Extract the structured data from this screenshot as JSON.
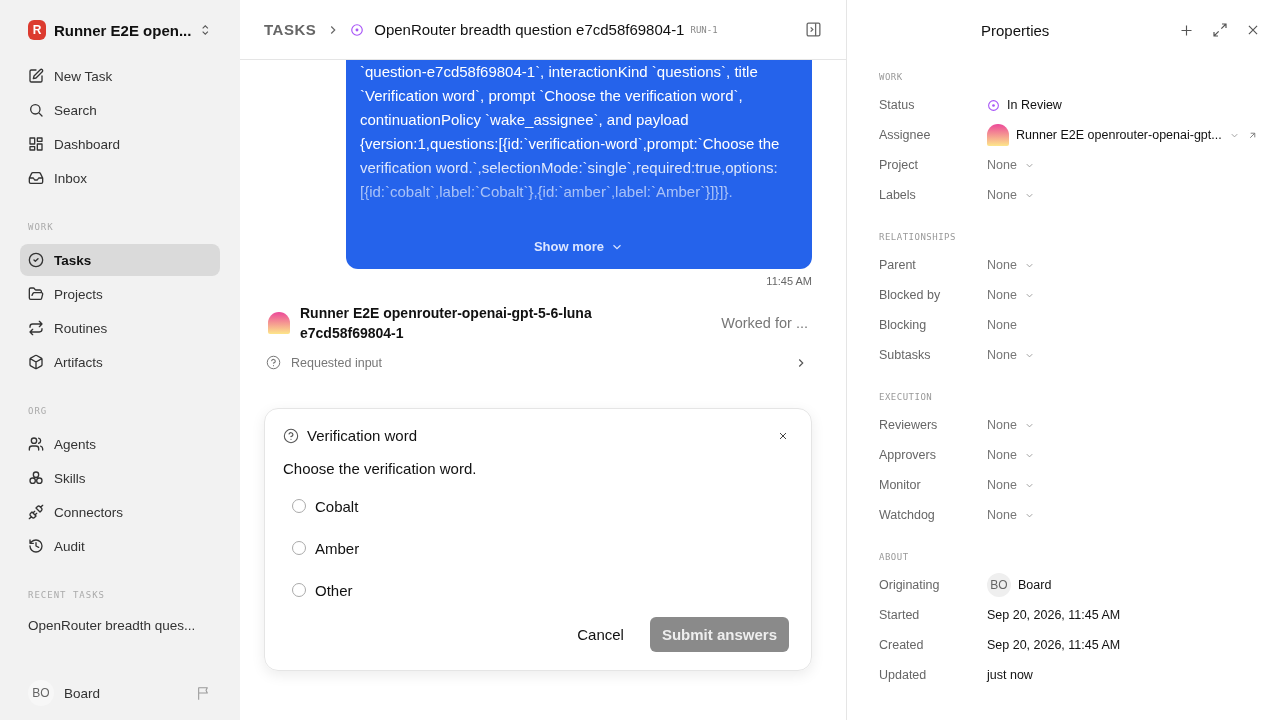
{
  "sidebar": {
    "workspace": {
      "logo_letter": "R",
      "name": "Runner E2E open..."
    },
    "groups": [
      {
        "items": [
          {
            "label": "New Task",
            "selected": false
          },
          {
            "label": "Search",
            "selected": false
          },
          {
            "label": "Dashboard",
            "selected": false
          },
          {
            "label": "Inbox",
            "selected": false
          }
        ]
      },
      {
        "heading": "WORK",
        "items": [
          {
            "label": "Tasks",
            "selected": true
          },
          {
            "label": "Projects",
            "selected": false
          },
          {
            "label": "Routines",
            "selected": false
          },
          {
            "label": "Artifacts",
            "selected": false
          }
        ]
      },
      {
        "heading": "ORG",
        "items": [
          {
            "label": "Agents",
            "selected": false
          },
          {
            "label": "Skills",
            "selected": false
          },
          {
            "label": "Connectors",
            "selected": false
          },
          {
            "label": "Audit",
            "selected": false
          }
        ]
      }
    ],
    "recent": {
      "heading": "RECENT TASKS",
      "items": [
        "OpenRouter breadth ques..."
      ]
    },
    "user": {
      "initials": "BO",
      "name": "Board"
    }
  },
  "header": {
    "breadcrumb": "TASKS",
    "title": "OpenRouter breadth question e7cd58f69804-1",
    "run": "RUN-1"
  },
  "message": {
    "text": "`question-e7cd58f69804-1`, interactionKind `questions`, title `Verification word`, prompt `Choose the verification word`, continuationPolicy `wake_assignee`, and payload {version:1,questions:[{id:`verification-word`,prompt:`Choose the verification word.`,selectionMode:`single`,required:true,options:[{id:`cobalt`,label:`Cobalt`},{id:`amber`,label:`Amber`}]}]}.",
    "show_more": "Show more",
    "time": "11:45 AM"
  },
  "run": {
    "agent": "Runner E2E openrouter-openai-gpt-5-6-luna e7cd58f69804-1",
    "duration": "Worked for ...",
    "activity": "Requested input"
  },
  "question": {
    "title": "Verification word",
    "prompt": "Choose the verification word.",
    "options": [
      {
        "label": "Cobalt",
        "selected": false
      },
      {
        "label": "Amber",
        "selected": false
      },
      {
        "label": "Other",
        "selected": false
      }
    ],
    "cancel": "Cancel",
    "submit": {
      "label": "Submit answers",
      "disabled": true
    }
  },
  "properties": {
    "title": "Properties",
    "sections": [
      {
        "heading": "WORK",
        "rows": [
          {
            "label": "Status",
            "kind": "status",
            "value": "In Review"
          },
          {
            "label": "Assignee",
            "kind": "agent",
            "value": "Runner E2E openrouter-openai-gpt..."
          },
          {
            "label": "Project",
            "kind": "select",
            "value": "None"
          },
          {
            "label": "Labels",
            "kind": "select",
            "value": "None"
          }
        ]
      },
      {
        "heading": "RELATIONSHIPS",
        "rows": [
          {
            "label": "Parent",
            "kind": "select",
            "value": "None"
          },
          {
            "label": "Blocked by",
            "kind": "select",
            "value": "None"
          },
          {
            "label": "Blocking",
            "kind": "plain",
            "value": "None"
          },
          {
            "label": "Subtasks",
            "kind": "select",
            "value": "None"
          }
        ]
      },
      {
        "heading": "EXECUTION",
        "rows": [
          {
            "label": "Reviewers",
            "kind": "select",
            "value": "None"
          },
          {
            "label": "Approvers",
            "kind": "select",
            "value": "None"
          },
          {
            "label": "Monitor",
            "kind": "select",
            "value": "None"
          },
          {
            "label": "Watchdog",
            "kind": "select",
            "value": "None"
          }
        ]
      },
      {
        "heading": "ABOUT",
        "rows": [
          {
            "label": "Originating",
            "kind": "user",
            "initials": "BO",
            "value": "Board"
          },
          {
            "label": "Started",
            "kind": "date",
            "value": "Sep 20, 2026, 11:45 AM"
          },
          {
            "label": "Created",
            "kind": "date",
            "value": "Sep 20, 2026, 11:45 AM"
          },
          {
            "label": "Updated",
            "kind": "date",
            "value": "just now"
          }
        ]
      }
    ]
  }
}
